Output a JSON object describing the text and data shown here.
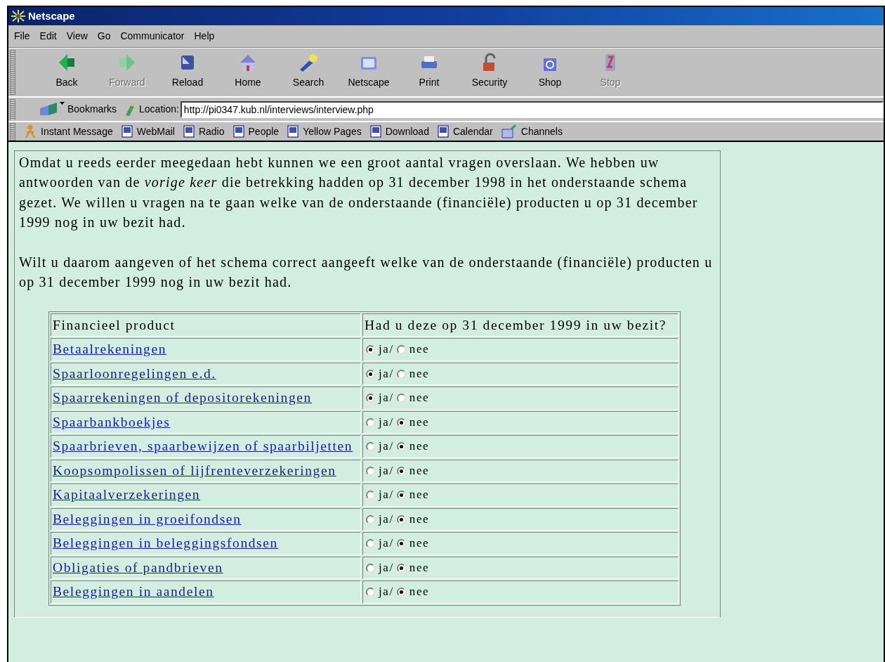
{
  "window": {
    "title": "Netscape"
  },
  "menu": [
    "File",
    "Edit",
    "View",
    "Go",
    "Communicator",
    "Help"
  ],
  "toolbar": [
    {
      "label": "Back",
      "disabled": false
    },
    {
      "label": "Forward",
      "disabled": true
    },
    {
      "label": "Reload",
      "disabled": false
    },
    {
      "label": "Home",
      "disabled": false
    },
    {
      "label": "Search",
      "disabled": false
    },
    {
      "label": "Netscape",
      "disabled": false
    },
    {
      "label": "Print",
      "disabled": false
    },
    {
      "label": "Security",
      "disabled": false
    },
    {
      "label": "Shop",
      "disabled": false
    },
    {
      "label": "Stop",
      "disabled": true
    }
  ],
  "location_bar": {
    "bookmarks": "Bookmarks",
    "label": "Location:",
    "url": "http://pi0347.kub.nl/interviews/interview.php"
  },
  "personal_toolbar": [
    {
      "label": "Instant Message",
      "kind": "person"
    },
    {
      "label": "WebMail",
      "kind": "page"
    },
    {
      "label": "Radio",
      "kind": "page"
    },
    {
      "label": "People",
      "kind": "page"
    },
    {
      "label": "Yellow Pages",
      "kind": "page"
    },
    {
      "label": "Download",
      "kind": "page"
    },
    {
      "label": "Calendar",
      "kind": "page"
    },
    {
      "label": "Channels",
      "kind": "folder"
    }
  ],
  "content": {
    "paragraphs": [
      "Omdat u reeds eerder meegedaan hebt kunnen we een groot aantal vragen overslaan. We hebben uw antwoorden van de *vorige keer* die betrekking hadden op 31 december 1998 in het onderstaande schema gezet. We willen u vragen na te gaan welke van de onderstaande (financiële) producten u op 31 december 1999 nog in uw bezit had.",
      "Wilt u daarom aangeven of het schema correct aangeeft welke van de onderstaande (financiële) producten u op 31 december 1999 nog in uw bezit had."
    ],
    "table": {
      "columns": [
        "Financieel product",
        "Had u deze op 31 december 1999 in uw bezit?"
      ],
      "rows": [
        {
          "product": "Betaalrekeningen",
          "options": [
            {
              "label": "ja/",
              "selected": true
            },
            {
              "label": "nee",
              "selected": false
            }
          ]
        },
        {
          "product": "Spaarloonregelingen e.d.",
          "options": [
            {
              "label": "ja/",
              "selected": true
            },
            {
              "label": "nee",
              "selected": false
            }
          ]
        },
        {
          "product": "Spaarrekeningen of depositorekeningen",
          "options": [
            {
              "label": "ja/",
              "selected": true
            },
            {
              "label": "nee",
              "selected": false
            }
          ]
        },
        {
          "product": "Spaarbankboekjes",
          "options": [
            {
              "label": "ja/",
              "selected": false
            },
            {
              "label": "nee",
              "selected": true
            }
          ]
        },
        {
          "product": "Spaarbrieven, spaarbewijzen of spaarbiljetten",
          "options": [
            {
              "label": "ja/",
              "selected": false
            },
            {
              "label": "nee",
              "selected": true
            }
          ]
        },
        {
          "product": "Koopsompolissen of lijfrenteverzekeringen",
          "options": [
            {
              "label": "ja/",
              "selected": false
            },
            {
              "label": "nee",
              "selected": true
            }
          ]
        },
        {
          "product": "Kapitaalverzekeringen",
          "options": [
            {
              "label": "ja/",
              "selected": false
            },
            {
              "label": "nee",
              "selected": true
            }
          ]
        },
        {
          "product": "Beleggingen in groeifondsen",
          "options": [
            {
              "label": "ja/",
              "selected": false
            },
            {
              "label": "nee",
              "selected": true
            }
          ]
        },
        {
          "product": "Beleggingen in beleggingsfondsen",
          "options": [
            {
              "label": "ja/",
              "selected": false
            },
            {
              "label": "nee",
              "selected": true
            }
          ]
        },
        {
          "product": "Obligaties of pandbrieven",
          "options": [
            {
              "label": "ja/",
              "selected": false
            },
            {
              "label": "nee",
              "selected": true
            }
          ]
        },
        {
          "product": "Beleggingen in aandelen",
          "options": [
            {
              "label": "ja/",
              "selected": false
            },
            {
              "label": "nee",
              "selected": true
            }
          ]
        }
      ]
    }
  }
}
